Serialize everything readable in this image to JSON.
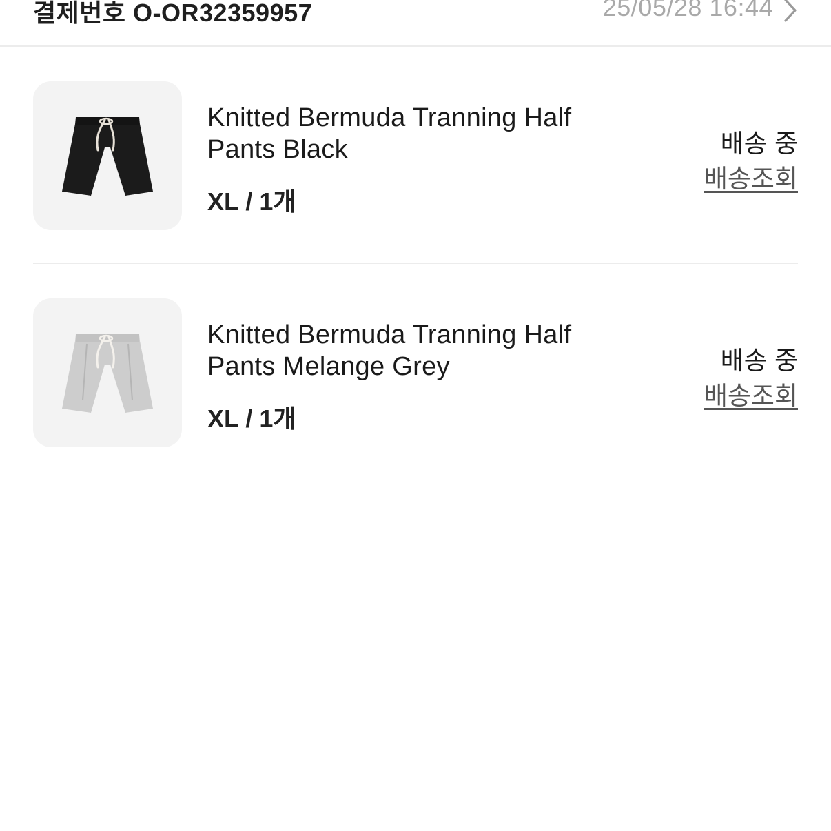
{
  "order": {
    "number_label": "결제번호 O-OR32359957",
    "date": "25/05/28 16:44",
    "chevron_icon": "chevron-right-icon"
  },
  "items": [
    {
      "name": "Knitted Bermuda Tranning Half Pants Black",
      "option": "XL / 1개",
      "status": "배송 중",
      "track_label": "배송조회",
      "color": "#1b1b1b"
    },
    {
      "name": "Knitted Bermuda Tranning Half Pants Melange Grey",
      "option": "XL / 1개",
      "status": "배송 중",
      "track_label": "배송조회",
      "color": "#c9c9c9"
    }
  ]
}
